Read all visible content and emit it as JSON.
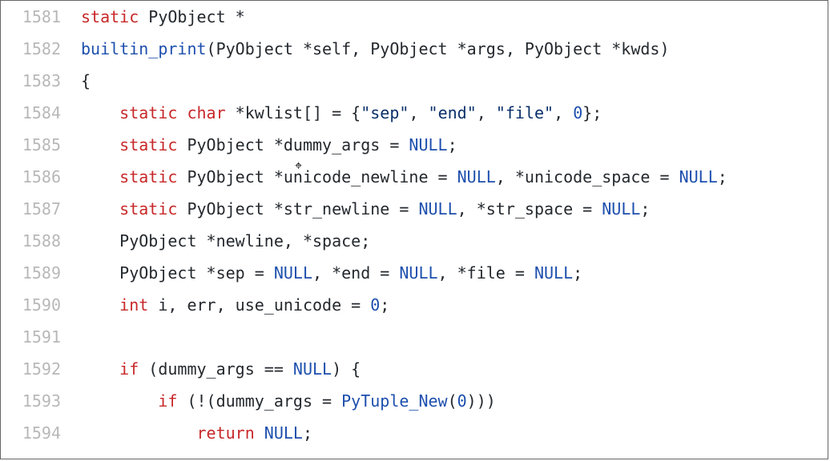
{
  "lines": [
    {
      "n": "1581",
      "tokens": [
        {
          "cls": "kw",
          "t": "static"
        },
        {
          "t": " PyObject *"
        }
      ]
    },
    {
      "n": "1582",
      "tokens": [
        {
          "cls": "fn",
          "t": "builtin_print"
        },
        {
          "t": "(PyObject *self, PyObject *args, PyObject *kwds)"
        }
      ]
    },
    {
      "n": "1583",
      "tokens": [
        {
          "t": "{"
        }
      ]
    },
    {
      "n": "1584",
      "tokens": [
        {
          "t": "    "
        },
        {
          "cls": "kw",
          "t": "static"
        },
        {
          "t": " "
        },
        {
          "cls": "kw",
          "t": "char"
        },
        {
          "t": " *kwlist[] = {"
        },
        {
          "cls": "str",
          "t": "\"sep\""
        },
        {
          "t": ", "
        },
        {
          "cls": "str",
          "t": "\"end\""
        },
        {
          "t": ", "
        },
        {
          "cls": "str",
          "t": "\"file\""
        },
        {
          "t": ", "
        },
        {
          "cls": "num",
          "t": "0"
        },
        {
          "t": "};"
        }
      ]
    },
    {
      "n": "1585",
      "tokens": [
        {
          "t": "    "
        },
        {
          "cls": "kw",
          "t": "static"
        },
        {
          "t": " PyObject *dummy_args = "
        },
        {
          "cls": "cst",
          "t": "NULL"
        },
        {
          "t": ";"
        }
      ]
    },
    {
      "n": "1586",
      "tokens": [
        {
          "t": "    "
        },
        {
          "cls": "kw",
          "t": "static"
        },
        {
          "t": " PyObject *unicode_newline = "
        },
        {
          "cls": "cst",
          "t": "NULL"
        },
        {
          "t": ", *unicode_space = "
        },
        {
          "cls": "cst",
          "t": "NULL"
        },
        {
          "t": ";"
        }
      ]
    },
    {
      "n": "1587",
      "tokens": [
        {
          "t": "    "
        },
        {
          "cls": "kw",
          "t": "static"
        },
        {
          "t": " PyObject *str_newline = "
        },
        {
          "cls": "cst",
          "t": "NULL"
        },
        {
          "t": ", *str_space = "
        },
        {
          "cls": "cst",
          "t": "NULL"
        },
        {
          "t": ";"
        }
      ]
    },
    {
      "n": "1588",
      "tokens": [
        {
          "t": "    PyObject *newline, *space;"
        }
      ]
    },
    {
      "n": "1589",
      "tokens": [
        {
          "t": "    PyObject *sep = "
        },
        {
          "cls": "cst",
          "t": "NULL"
        },
        {
          "t": ", *end = "
        },
        {
          "cls": "cst",
          "t": "NULL"
        },
        {
          "t": ", *file = "
        },
        {
          "cls": "cst",
          "t": "NULL"
        },
        {
          "t": ";"
        }
      ]
    },
    {
      "n": "1590",
      "tokens": [
        {
          "t": "    "
        },
        {
          "cls": "kw",
          "t": "int"
        },
        {
          "t": " i, err, use_unicode = "
        },
        {
          "cls": "num",
          "t": "0"
        },
        {
          "t": ";"
        }
      ]
    },
    {
      "n": "1591",
      "tokens": [
        {
          "t": ""
        }
      ]
    },
    {
      "n": "1592",
      "tokens": [
        {
          "t": "    "
        },
        {
          "cls": "kw",
          "t": "if"
        },
        {
          "t": " (dummy_args == "
        },
        {
          "cls": "cst",
          "t": "NULL"
        },
        {
          "t": ") {"
        }
      ]
    },
    {
      "n": "1593",
      "tokens": [
        {
          "t": "        "
        },
        {
          "cls": "kw",
          "t": "if"
        },
        {
          "t": " (!(dummy_args = "
        },
        {
          "cls": "fn",
          "t": "PyTuple_New"
        },
        {
          "t": "("
        },
        {
          "cls": "num",
          "t": "0"
        },
        {
          "t": ")))"
        }
      ]
    },
    {
      "n": "1594",
      "tokens": [
        {
          "t": "            "
        },
        {
          "cls": "kw",
          "t": "return"
        },
        {
          "t": " "
        },
        {
          "cls": "cst",
          "t": "NULL"
        },
        {
          "t": ";"
        }
      ]
    }
  ]
}
